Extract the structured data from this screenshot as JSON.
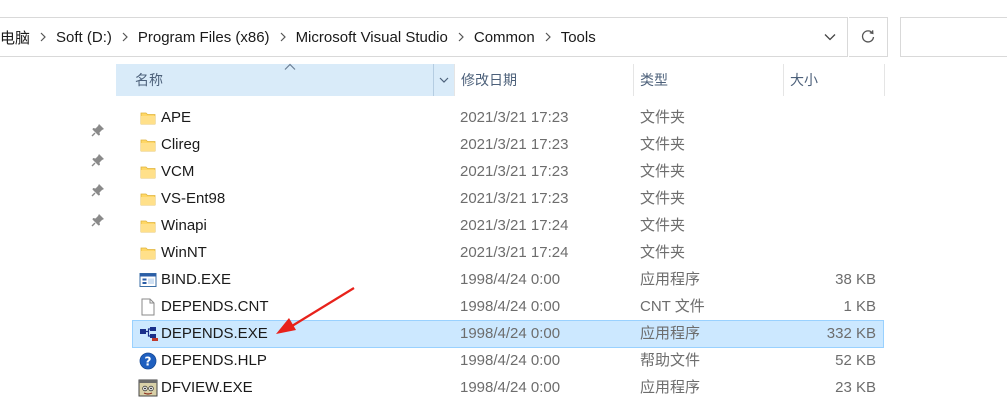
{
  "address_bar": {
    "breadcrumbs": [
      "电脑",
      "Soft (D:)",
      "Program Files (x86)",
      "Microsoft Visual Studio",
      "Common",
      "Tools"
    ]
  },
  "search": {
    "placeholder": ""
  },
  "columns": {
    "name": "名称",
    "date": "修改日期",
    "type": "类型",
    "size": "大小"
  },
  "sort": {
    "column": "name",
    "direction": "ascending"
  },
  "files": [
    {
      "name": "APE",
      "date": "2021/3/21 17:23",
      "type": "文件夹",
      "size": "",
      "icon": "folder-icon"
    },
    {
      "name": "Clireg",
      "date": "2021/3/21 17:23",
      "type": "文件夹",
      "size": "",
      "icon": "folder-icon"
    },
    {
      "name": "VCM",
      "date": "2021/3/21 17:23",
      "type": "文件夹",
      "size": "",
      "icon": "folder-icon"
    },
    {
      "name": "VS-Ent98",
      "date": "2021/3/21 17:23",
      "type": "文件夹",
      "size": "",
      "icon": "folder-icon"
    },
    {
      "name": "Winapi",
      "date": "2021/3/21 17:24",
      "type": "文件夹",
      "size": "",
      "icon": "folder-icon"
    },
    {
      "name": "WinNT",
      "date": "2021/3/21 17:24",
      "type": "文件夹",
      "size": "",
      "icon": "folder-icon"
    },
    {
      "name": "BIND.EXE",
      "date": "1998/4/24 0:00",
      "type": "应用程序",
      "size": "38 KB",
      "icon": "exe-window-icon"
    },
    {
      "name": "DEPENDS.CNT",
      "date": "1998/4/24 0:00",
      "type": "CNT 文件",
      "size": "1 KB",
      "icon": "blank-file-icon"
    },
    {
      "name": "DEPENDS.EXE",
      "date": "1998/4/24 0:00",
      "type": "应用程序",
      "size": "332 KB",
      "icon": "depends-app-icon",
      "selected": true
    },
    {
      "name": "DEPENDS.HLP",
      "date": "1998/4/24 0:00",
      "type": "帮助文件",
      "size": "52 KB",
      "icon": "help-file-icon"
    },
    {
      "name": "DFVIEW.EXE",
      "date": "1998/4/24 0:00",
      "type": "应用程序",
      "size": "23 KB",
      "icon": "dfview-app-icon"
    }
  ],
  "colors": {
    "selection_bg": "#cce8ff",
    "selection_border": "#99d1ff",
    "header_active_bg": "#d9ebf9",
    "folder_yellow": "#ffd766",
    "annotation_red": "#e8221b"
  }
}
